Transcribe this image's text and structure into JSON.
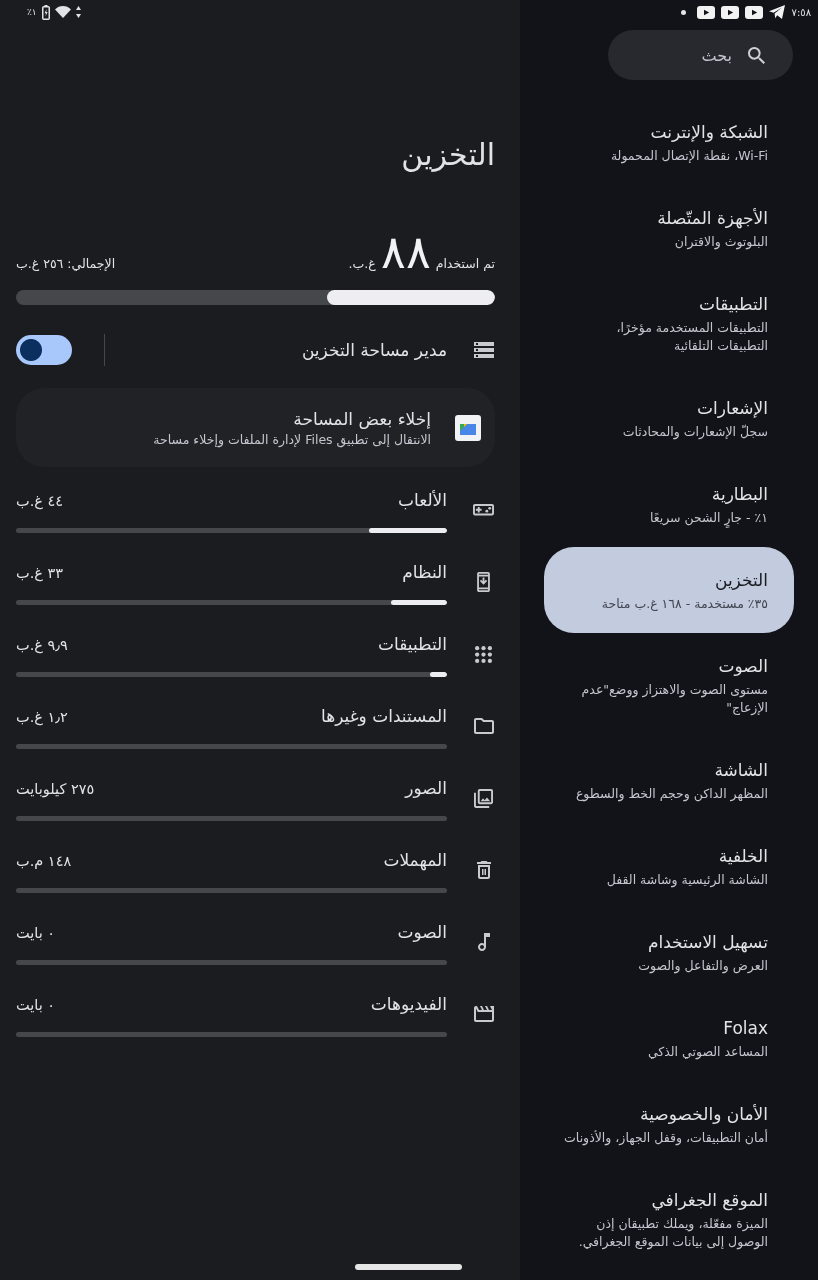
{
  "status_bar": {
    "battery_percent": "٪١",
    "time": "٧:٥٨"
  },
  "sidebar": {
    "search": {
      "placeholder": "بحث"
    },
    "items": [
      {
        "title": "الشبكة والإنترنت",
        "subtitle": "Wi-Fi، نقطة الإتصال المحمولة",
        "selected": false
      },
      {
        "title": "الأجهزة المتّصلة",
        "subtitle": "البلوتوث والاقتران",
        "selected": false
      },
      {
        "title": "التطبيقات",
        "subtitle": "التطبيقات المستخدمة مؤخرًا، التطبيقات التلقائية",
        "selected": false
      },
      {
        "title": "الإشعارات",
        "subtitle": "سجلّ الإشعارات والمحادثات",
        "selected": false
      },
      {
        "title": "البطارية",
        "subtitle": "١٪ - جارٍ الشحن سريعًا",
        "selected": false
      },
      {
        "title": "التخزين",
        "subtitle": "٣٥٪ مستخدمة - ١٦٨ غ.ب متاحة",
        "selected": true
      },
      {
        "title": "الصوت",
        "subtitle": "مستوى الصوت والاهتزاز ووضع\"عدم الإزعاج\"",
        "selected": false
      },
      {
        "title": "الشاشة",
        "subtitle": "المظهر الداكن وحجم الخط والسطوع",
        "selected": false
      },
      {
        "title": "الخلفية",
        "subtitle": "الشاشة الرئيسية وشاشة القفل",
        "selected": false
      },
      {
        "title": "تسهيل الاستخدام",
        "subtitle": "العرض والتفاعل والصوت",
        "selected": false
      },
      {
        "title": "Folax",
        "subtitle": "المساعد الصوتي الذكي",
        "selected": false
      },
      {
        "title": "الأمان والخصوصية",
        "subtitle": "أمان التطبيقات، وقفل الجهاز، والأذونات",
        "selected": false
      },
      {
        "title": "الموقع الجغرافي",
        "subtitle": "الميزة مفعّلة، ويملك تطبيقان إذن الوصول إلى بيانات الموقع الجغرافي.",
        "selected": false
      }
    ]
  },
  "storage": {
    "title": "التخزين",
    "used_label": "تم استخدام",
    "used_amount": "٨٨",
    "used_unit": "غ.ب.",
    "total": "الإجمالي: ٢٥٦ غ.ب",
    "level": 0.35
  },
  "storage_manager": {
    "label": "مدير مساحة التخزين",
    "on": true
  },
  "free_up_card": {
    "title": "إخلاء بعض المساحة",
    "subtitle": "الانتقال إلى تطبيق Files لإدارة الملفات وإخلاء مساحة"
  },
  "categories": [
    {
      "kind": "games",
      "label": "الألعاب",
      "size": "٤٤ غ.ب",
      "level": 0.18
    },
    {
      "kind": "system",
      "label": "النظام",
      "size": "٣٣ غ.ب",
      "level": 0.13
    },
    {
      "kind": "apps",
      "label": "التطبيقات",
      "size": "٩٫٩ غ.ب",
      "level": 0.04
    },
    {
      "kind": "documents",
      "label": "المستندات وغيرها",
      "size": "١٫٢ غ.ب"
    },
    {
      "kind": "images",
      "label": "الصور",
      "size": "٢٧٥ كيلوبايت"
    },
    {
      "kind": "trash",
      "label": "المهملات",
      "size": "١٤٨ م.ب"
    },
    {
      "kind": "audio",
      "label": "الصوت",
      "size": "٠ بايت"
    },
    {
      "kind": "videos",
      "label": "الفيديوهات",
      "size": "٠ بايت"
    }
  ]
}
